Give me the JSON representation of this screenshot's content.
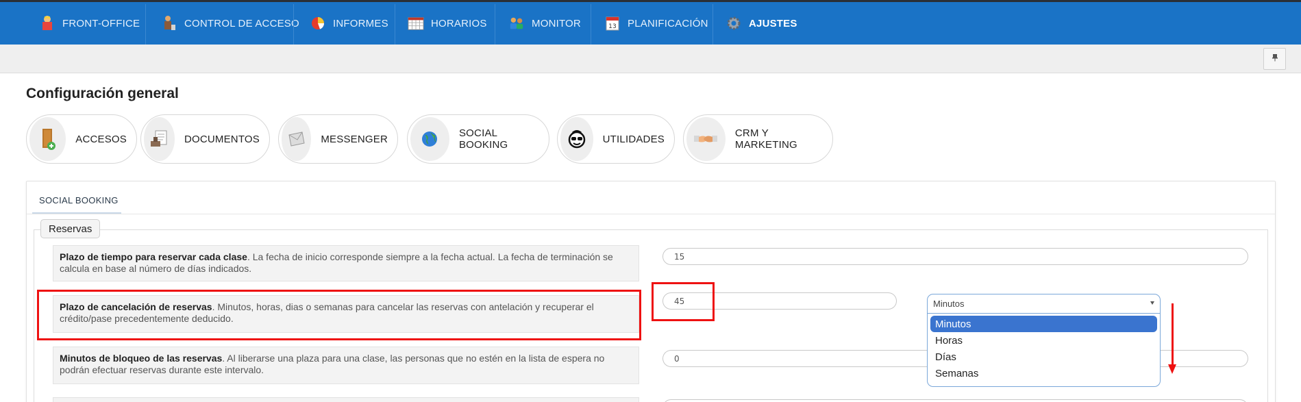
{
  "nav": {
    "items": [
      {
        "label": "FRONT-OFFICE",
        "icon": "front-office-person-icon"
      },
      {
        "label": "CONTROL DE ACCESO",
        "icon": "access-control-icon"
      },
      {
        "label": "INFORMES",
        "icon": "pie-chart-icon"
      },
      {
        "label": "HORARIOS",
        "icon": "calendar-grid-icon"
      },
      {
        "label": "MONITOR",
        "icon": "people-group-icon"
      },
      {
        "label": "PLANIFICACIÓN",
        "icon": "calendar-13-icon"
      },
      {
        "label": "AJUSTES",
        "icon": "gear-icon"
      }
    ],
    "active": "AJUSTES",
    "colors": {
      "bar": "#1a73c6",
      "top_border": "#2a2f36"
    }
  },
  "subbar": {
    "pin_icon": "pin-icon"
  },
  "page": {
    "title": "Configuración general"
  },
  "categories": [
    {
      "label": "ACCESOS",
      "icon": "door-exit-icon"
    },
    {
      "label": "DOCUMENTOS",
      "icon": "document-stamp-icon"
    },
    {
      "label": "MESSENGER",
      "icon": "envelope-icon"
    },
    {
      "label": "SOCIAL BOOKING",
      "icon": "globe-icon"
    },
    {
      "label": "UTILIDADES",
      "icon": "smiley-sunglasses-icon"
    },
    {
      "label": "CRM Y MARKETING",
      "icon": "handshake-icon"
    }
  ],
  "panel": {
    "tab": "SOCIAL BOOKING",
    "fieldset_legend": "Reservas",
    "rows": [
      {
        "title": "Plazo de tiempo para reservar cada clase",
        "text": ". La fecha de inicio corresponde siempre a la fecha actual. La fecha de terminación se calcula en base al número de días indicados.",
        "value": "15"
      },
      {
        "title": "Plazo de cancelación de reservas",
        "text": ". Minutos, horas, dias o semanas para cancelar las reservas con antelación y recuperar el crédito/pase precedentemente deducido.",
        "value": "45",
        "unit_selected": "Minutos",
        "unit_options": [
          "Minutos",
          "Horas",
          "Días",
          "Semanas"
        ]
      },
      {
        "title": "Minutos de bloqueo de las reservas",
        "text": ". Al liberarse una plaza para una clase, las personas que no estén en la lista de espera no podrán efectuar reservas durante este intervalo.",
        "value": "0"
      }
    ]
  },
  "annotation_color": "#ee1111"
}
